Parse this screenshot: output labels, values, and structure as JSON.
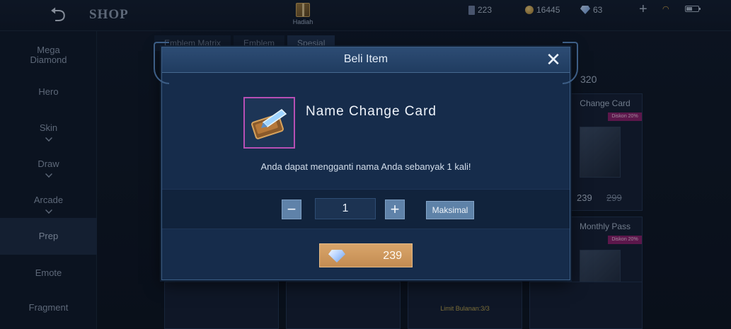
{
  "header": {
    "back_icon": "back-arrow-icon",
    "title": "SHOP",
    "gift_label": "Hadiah"
  },
  "currencies": {
    "tickets": "223",
    "battle_points": "16445",
    "diamonds": "63"
  },
  "sidebar": {
    "items": [
      {
        "label": "Mega Diamond"
      },
      {
        "label": "Hero"
      },
      {
        "label": "Skin"
      },
      {
        "label": "Draw"
      },
      {
        "label": "Arcade"
      },
      {
        "label": "Prep"
      },
      {
        "label": "Emote"
      },
      {
        "label": "Fragment"
      }
    ]
  },
  "sub_tabs": [
    "Emblem Matrix",
    "Emblem",
    "Spesial"
  ],
  "shop_cards": {
    "price_top": "320",
    "name_change": {
      "title": "Change Card",
      "discount": "Diskon 20%",
      "price": "239",
      "old_price": "299"
    },
    "monthly_pass": {
      "title": "Monthly Pass",
      "discount": "Diskon 20%"
    },
    "bottom": {
      "limit_label": "Limit Bulanan:3/3"
    }
  },
  "modal": {
    "title": "Beli Item",
    "item_name": "Name Change Card",
    "description": "Anda dapat mengganti nama Anda sebanyak 1 kali!",
    "quantity": "1",
    "max_label": "Maksimal",
    "price": "239",
    "colors": {
      "frame": "#162c4b",
      "buy_button": "#d9a56a",
      "item_border": "#b64fb4"
    }
  }
}
